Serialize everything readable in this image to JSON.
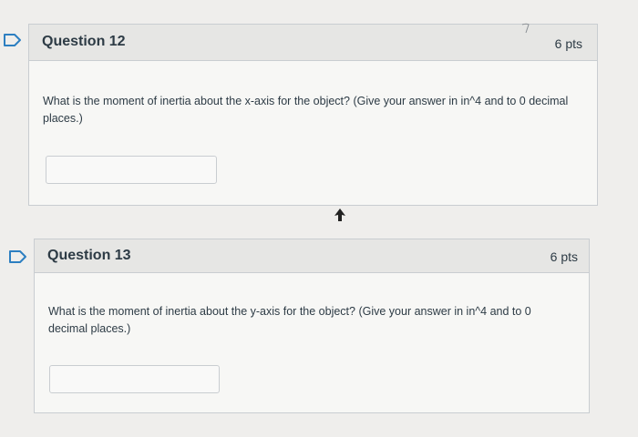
{
  "questions": [
    {
      "title": "Question 12",
      "points": "6 pts",
      "text": "What is the moment of inertia about the x-axis for the object? (Give your answer in in^4 and to 0 decimal places.)",
      "answer_value": ""
    },
    {
      "title": "Question 13",
      "points": "6 pts",
      "text": "What is the moment of inertia about the y-axis for the object? (Give your answer in in^4 and to 0 decimal places.)",
      "answer_value": ""
    }
  ],
  "icons": {
    "flag": "bookmark-flag-icon",
    "cursor": "mouse-pointer-icon"
  },
  "colors": {
    "page_bg": "#efeeec",
    "header_bg": "#e6e6e4",
    "body_bg": "#f7f7f5",
    "border": "#c9cdd1",
    "text": "#2d3b45",
    "flag_outline": "#2d7fc1"
  }
}
